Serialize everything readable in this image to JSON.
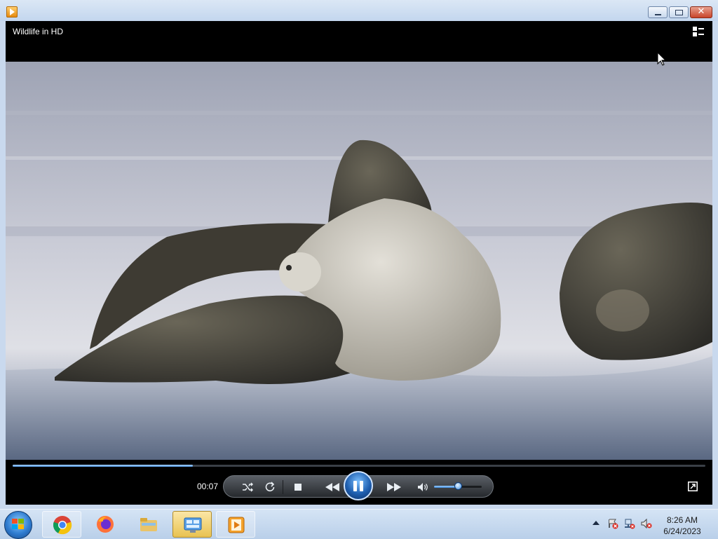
{
  "window": {
    "title_bar_icon": "media-player-icon",
    "buttons": [
      "minimize",
      "maximize",
      "close"
    ],
    "close_glyph": "✕"
  },
  "player": {
    "video_title": "Wildlife in HD",
    "current_time": "00:07",
    "progress": 0.26,
    "volume": 0.52,
    "state": "playing"
  },
  "controls": {
    "shuffle_icon": "shuffle-icon",
    "repeat_icon": "repeat-icon",
    "stop_icon": "stop-icon",
    "previous_icon": "rewind-icon",
    "play_pause_icon": "pause-icon",
    "next_icon": "fast-forward-icon",
    "mute_icon": "speaker-icon",
    "fullscreen_icon": "fullscreen-icon",
    "switch_to_library_icon": "switch-to-library-icon"
  },
  "taskbar": {
    "items": [
      "chrome",
      "firefox",
      "file-explorer",
      "control-panel",
      "windows-media-player"
    ],
    "clock_time": "8:26 AM",
    "clock_date": "6/24/2023"
  },
  "colors": {
    "accent_blue": "#3b86d8",
    "taskbar_active": "#e8c252",
    "close_red": "#c8442a"
  }
}
